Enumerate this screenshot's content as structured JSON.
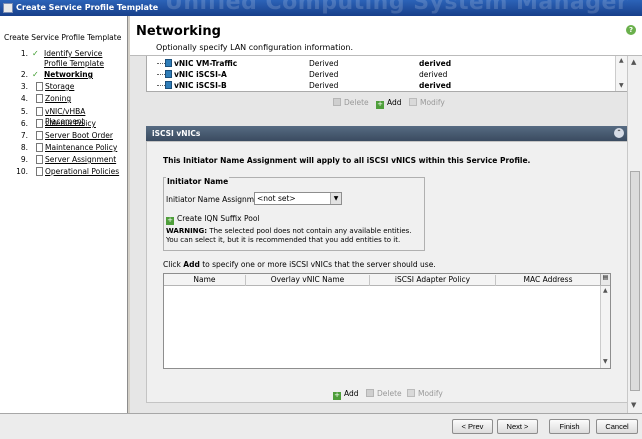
{
  "window": {
    "title": "Create Service Profile Template",
    "watermark": "Unified Computing System Manager"
  },
  "wizard": {
    "heading": "Create Service Profile Template",
    "steps": [
      {
        "num": "1.",
        "label": "Identify Service Profile Template",
        "done": true
      },
      {
        "num": "2.",
        "label": "Networking",
        "done": true,
        "current": true
      },
      {
        "num": "3.",
        "label": "Storage"
      },
      {
        "num": "4.",
        "label": "Zoning"
      },
      {
        "num": "5.",
        "label": "vNIC/vHBA Placement"
      },
      {
        "num": "6.",
        "label": "vMedia Policy"
      },
      {
        "num": "7.",
        "label": "Server Boot Order"
      },
      {
        "num": "8.",
        "label": "Maintenance Policy"
      },
      {
        "num": "9.",
        "label": "Server Assignment"
      },
      {
        "num": "10.",
        "label": "Operational Policies"
      }
    ]
  },
  "page": {
    "title": "Networking",
    "subtitle": "Optionally specify LAN configuration information."
  },
  "vnics": {
    "rows": [
      {
        "name": "vNIC VM-Traffic",
        "col2": "Derived",
        "col3": "derived",
        "bold3": true
      },
      {
        "name": "vNIC iSCSI-A",
        "col2": "Derived",
        "col3": "derived",
        "bold3": false
      },
      {
        "name": "vNIC iSCSI-B",
        "col2": "Derived",
        "col3": "derived",
        "bold3": true
      }
    ],
    "buttons": {
      "delete": "Delete",
      "add": "Add",
      "modify": "Modify"
    }
  },
  "iscsi": {
    "section_title": "iSCSI vNICs",
    "assign_note": "This Initiator Name Assignment will apply to all iSCSI vNICS within this Service Profile.",
    "initiator_group": "Initiator Name",
    "initiator_label": "Initiator Name Assignment:",
    "initiator_value": "<not set>",
    "iqn_link": "Create IQN Suffix Pool",
    "warning_label": "WARNING:",
    "warning_text": "The selected pool does not contain any available entities.",
    "warning_text2": "You can select it, but it is recommended that you add entities to it.",
    "click_prefix": "Click",
    "click_add": "Add",
    "click_suffix": "to specify one or more iSCSI vNICs that the server should use.",
    "columns": [
      "Name",
      "Overlay vNIC Name",
      "iSCSI Adapter Policy",
      "MAC Address"
    ],
    "buttons": {
      "add": "Add",
      "delete": "Delete",
      "modify": "Modify"
    }
  },
  "footer": {
    "prev": "< Prev",
    "next": "Next >",
    "finish": "Finish",
    "cancel": "Cancel"
  }
}
